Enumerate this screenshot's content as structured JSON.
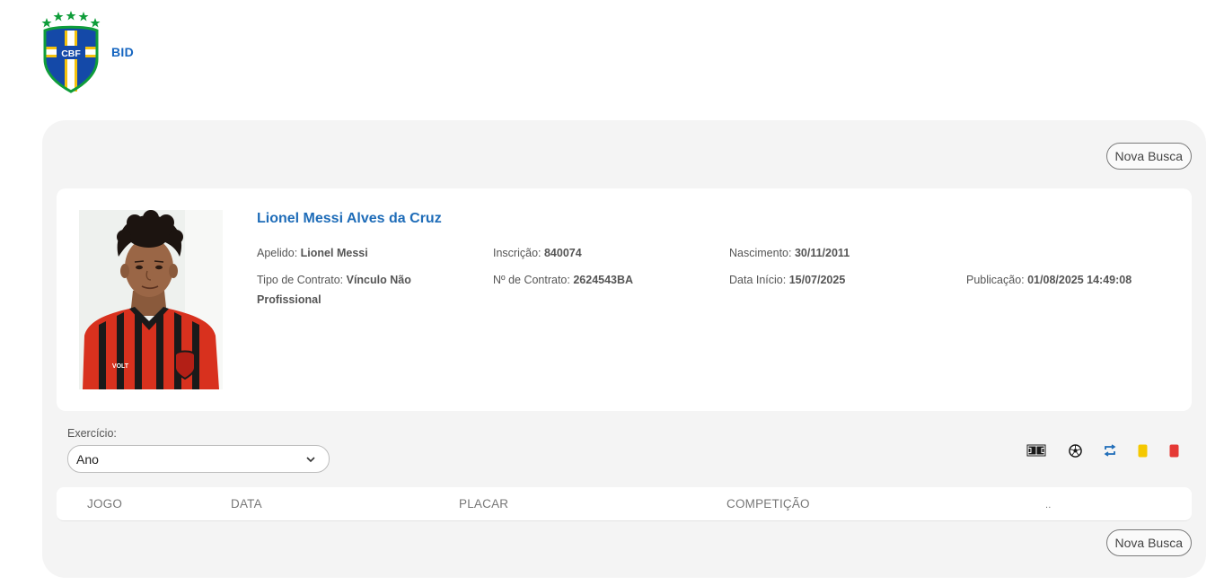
{
  "header": {
    "brand": "BID",
    "logo_text": "CBF"
  },
  "actions": {
    "new_search_top": "Nova Busca",
    "new_search_bottom": "Nova Busca"
  },
  "player": {
    "name": "Lionel Messi Alves da Cruz",
    "nickname_label": "Apelido:",
    "nickname": "Lionel Messi",
    "registration_label": "Inscrição:",
    "registration": "840074",
    "birth_label": "Nascimento:",
    "birth": "30/11/2011",
    "contract_type_label": "Tipo de Contrato:",
    "contract_type": "Vínculo Não Profissional",
    "contract_number_label": "Nº de Contrato:",
    "contract_number": "2624543BA",
    "start_date_label": "Data Início:",
    "start_date": "15/07/2025",
    "publication_label": "Publicação:",
    "publication": "01/08/2025 14:49:08",
    "photo_icon": "player-photo"
  },
  "filter": {
    "exercise_label": "Exercício:",
    "year_select_value": "Ano"
  },
  "legend_icons": [
    "field-icon",
    "ball-icon",
    "substitution-icon",
    "yellow-card-icon",
    "red-card-icon"
  ],
  "colors": {
    "accent": "#1e6cb8",
    "panel": "#f4f4f4",
    "yellow_card": "#f5c800",
    "red_card": "#e53935"
  },
  "table": {
    "columns": [
      "JOGO",
      "DATA",
      "PLACAR",
      "COMPETIÇÃO",
      ".."
    ]
  }
}
